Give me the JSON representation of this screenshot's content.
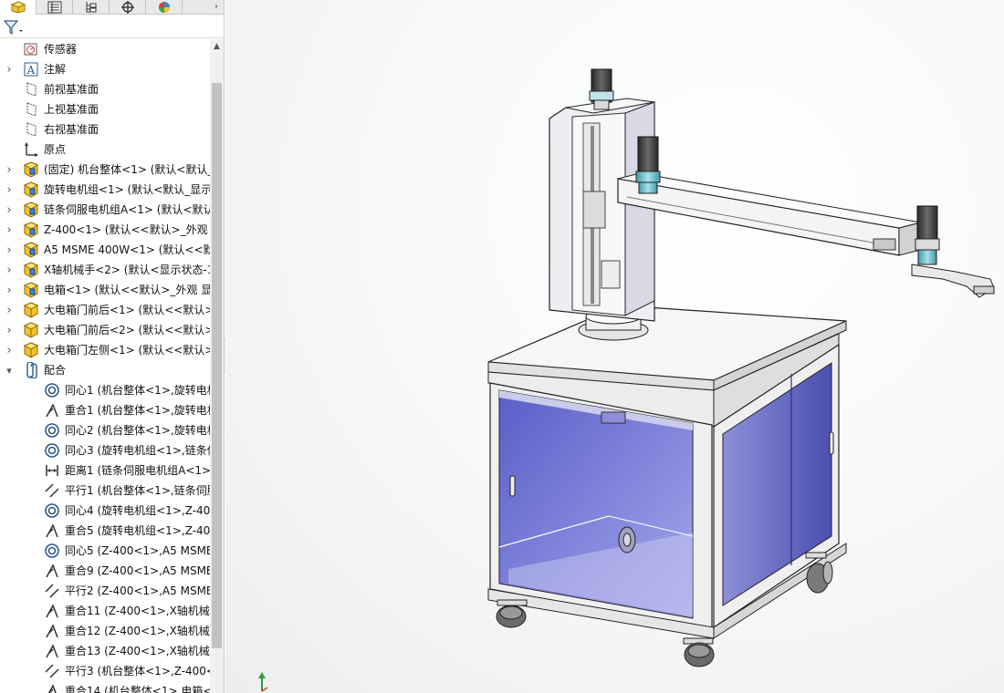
{
  "panel": {
    "tabs": [
      {
        "name": "feature-manager",
        "icon": "feature-manager-icon"
      },
      {
        "name": "property-manager",
        "icon": "property-manager-icon"
      },
      {
        "name": "configuration-manager",
        "icon": "configuration-manager-icon"
      },
      {
        "name": "dimxpert-manager",
        "icon": "dimxpert-icon"
      },
      {
        "name": "display-manager",
        "icon": "display-manager-icon"
      }
    ],
    "filter_icon": "filter-icon"
  },
  "tree": {
    "items": [
      {
        "label": "传感器",
        "icon": "sensor-icon",
        "expandable": false
      },
      {
        "label": "注解",
        "icon": "annotation-icon",
        "expandable": true
      },
      {
        "label": "前视基准面",
        "icon": "plane-icon",
        "expandable": false
      },
      {
        "label": "上视基准面",
        "icon": "plane-icon",
        "expandable": false
      },
      {
        "label": "右视基准面",
        "icon": "plane-icon",
        "expandable": false
      },
      {
        "label": "原点",
        "icon": "origin-icon",
        "expandable": false
      },
      {
        "label": "(固定) 机台整体<1> (默认<默认_显",
        "icon": "assembly-icon",
        "expandable": true
      },
      {
        "label": "旋转电机组<1> (默认<默认_显示状",
        "icon": "assembly-icon",
        "expandable": true
      },
      {
        "label": "链条伺服电机组A<1> (默认<默认_",
        "icon": "assembly-icon",
        "expandable": true
      },
      {
        "label": "Z-400<1> (默认<<默认>_外观 显",
        "icon": "assembly-icon",
        "expandable": true
      },
      {
        "label": "A5 MSME 400W<1> (默认<<默",
        "icon": "assembly-icon",
        "expandable": true
      },
      {
        "label": "X轴机械手<2> (默认<显示状态-1",
        "icon": "assembly-icon",
        "expandable": true
      },
      {
        "label": "电箱<1> (默认<<默认>_外观 显示",
        "icon": "assembly-icon",
        "expandable": true
      },
      {
        "label": "大电箱门前后<1> (默认<<默认>_",
        "icon": "part-icon",
        "expandable": true
      },
      {
        "label": "大电箱门前后<2> (默认<<默认>_",
        "icon": "part-icon",
        "expandable": true
      },
      {
        "label": "大电箱门左侧<1> (默认<<默认>_",
        "icon": "part-icon",
        "expandable": true
      },
      {
        "label": "配合",
        "icon": "mates-icon",
        "expandable": true,
        "expanded": true
      }
    ],
    "mates": [
      {
        "label": "同心1 (机台整体<1>,旋转电机",
        "icon": "concentric-mate-icon"
      },
      {
        "label": "重合1 (机台整体<1>,旋转电机",
        "icon": "coincident-mate-icon"
      },
      {
        "label": "同心2 (机台整体<1>,旋转电机",
        "icon": "concentric-mate-icon"
      },
      {
        "label": "同心3 (旋转电机组<1>,链条伺",
        "icon": "concentric-mate-icon"
      },
      {
        "label": "距离1 (链条伺服电机组A<1>,",
        "icon": "distance-mate-icon"
      },
      {
        "label": "平行1 (机台整体<1>,链条伺服",
        "icon": "parallel-mate-icon"
      },
      {
        "label": "同心4 (旋转电机组<1>,Z-400",
        "icon": "concentric-mate-icon"
      },
      {
        "label": "重合5 (旋转电机组<1>,Z-400",
        "icon": "coincident-mate-icon"
      },
      {
        "label": "同心5 (Z-400<1>,A5 MSME",
        "icon": "concentric-mate-icon"
      },
      {
        "label": "重合9 (Z-400<1>,A5 MSME",
        "icon": "coincident-mate-icon"
      },
      {
        "label": "平行2 (Z-400<1>,A5 MSME",
        "icon": "parallel-mate-icon"
      },
      {
        "label": "重合11 (Z-400<1>,X轴机械手",
        "icon": "coincident-mate-icon"
      },
      {
        "label": "重合12 (Z-400<1>,X轴机械手",
        "icon": "coincident-mate-icon"
      },
      {
        "label": "重合13 (Z-400<1>,X轴机械手",
        "icon": "coincident-mate-icon"
      },
      {
        "label": "平行3 (机台整体<1>,Z-400<1",
        "icon": "parallel-mate-icon"
      },
      {
        "label": "重合14 (机台整体<1>,电箱<1",
        "icon": "coincident-mate-icon"
      }
    ]
  },
  "viewport": {
    "content": "3D assembly model",
    "triad_icon": "triad-icon"
  }
}
